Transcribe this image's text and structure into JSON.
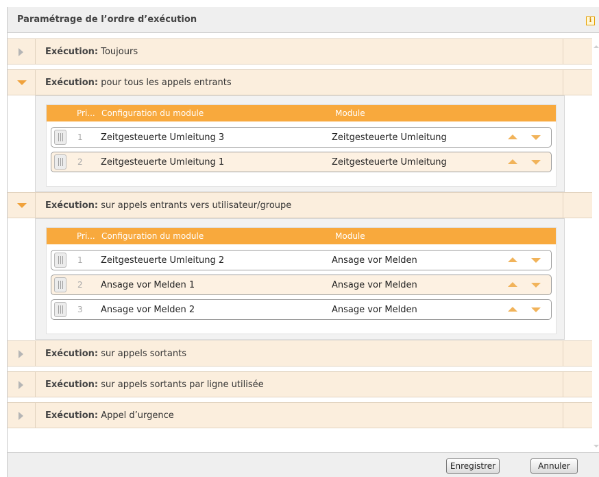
{
  "dialog": {
    "title": "Paramétrage de l’ordre d’exécution",
    "info_icon": "i"
  },
  "sections": [
    {
      "prefix": "Exécution:",
      "label": "Toujours",
      "expanded": false
    },
    {
      "prefix": "Exécution:",
      "label": "pour tous les appels entrants",
      "expanded": true
    },
    {
      "prefix": "Exécution:",
      "label": "sur appels entrants vers utilisateur/groupe",
      "expanded": true
    },
    {
      "prefix": "Exécution:",
      "label": "sur appels sortants",
      "expanded": false
    },
    {
      "prefix": "Exécution:",
      "label": "sur appels sortants par ligne utilisée",
      "expanded": false
    },
    {
      "prefix": "Exécution:",
      "label": "Appel d’urgence",
      "expanded": false
    }
  ],
  "table_headers": {
    "priority": "Pri...",
    "config": "Configuration du module",
    "module": "Module"
  },
  "tables": [
    {
      "rows": [
        {
          "priority": "1",
          "config": "Zeitgesteuerte Umleitung 3",
          "module": "Zeitgesteuerte Umleitung"
        },
        {
          "priority": "2",
          "config": "Zeitgesteuerte Umleitung 1",
          "module": "Zeitgesteuerte Umleitung"
        }
      ]
    },
    {
      "rows": [
        {
          "priority": "1",
          "config": "Zeitgesteuerte Umleitung 2",
          "module": "Ansage vor Melden"
        },
        {
          "priority": "2",
          "config": "Ansage vor Melden 1",
          "module": "Ansage vor Melden"
        },
        {
          "priority": "3",
          "config": "Ansage vor Melden 2",
          "module": "Ansage vor Melden"
        }
      ]
    }
  ],
  "footer": {
    "save_label": "Enregistrer",
    "cancel_label": "Annuler"
  },
  "colors": {
    "accent": "#f8a93d",
    "section_bg": "#fbeedd",
    "row_alt_bg": "#fdf1e2"
  }
}
